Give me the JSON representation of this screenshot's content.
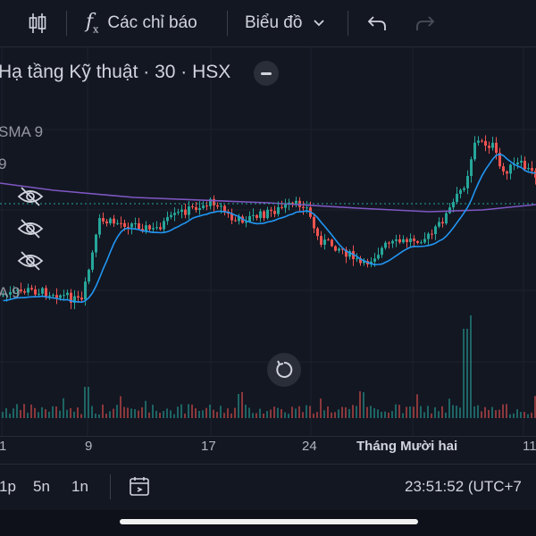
{
  "toolbar": {
    "indicators_label": "Các chỉ báo",
    "chart_type_label": "Biểu đồ"
  },
  "chart": {
    "symbol_title": "Hạ tầng Kỹ thuật · 30 · HSX",
    "legend_sma_label": "SMA 9",
    "legend_line2_fragment": "9",
    "legend_line3_fragment": "A 9",
    "colors": {
      "up": "#26a69a",
      "down": "#ef5350",
      "sma_fast": "#2196f3",
      "sma_slow": "#7e57c2"
    }
  },
  "xaxis": {
    "labels": [
      "1",
      "9",
      "17",
      "24",
      "Tháng Mười hai",
      "11"
    ]
  },
  "bottombar": {
    "intervals": [
      "1p",
      "5n",
      "1n"
    ],
    "clock": "23:51:52 (UTC+7"
  }
}
